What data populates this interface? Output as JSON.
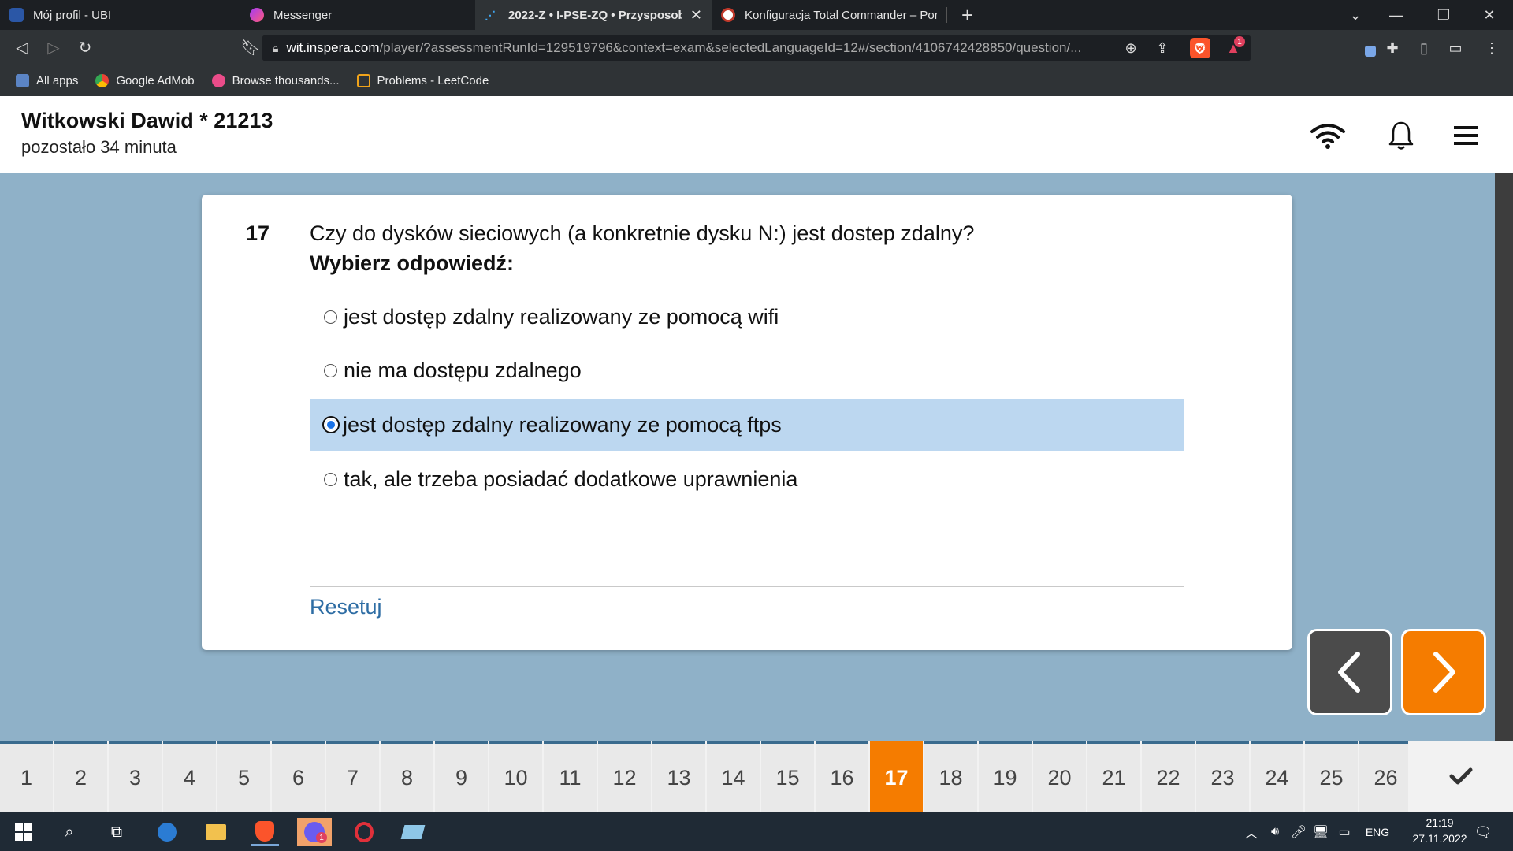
{
  "browser": {
    "tabs": [
      {
        "title": "Mój profil - UBI",
        "active": false
      },
      {
        "title": "Messenger",
        "active": false
      },
      {
        "title": "2022-Z • I-PSE-ZQ • Przysposobie",
        "active": true
      },
      {
        "title": "Konfiguracja Total Commander – Pom",
        "active": false
      }
    ],
    "url_host": "wit.inspera.com",
    "url_rest": "/player/?assessmentRunId=129519796&context=exam&selectedLanguageId=12#/section/4106742428850/question/...",
    "bookmarks": [
      "All apps",
      "Google AdMob",
      "Browse thousands...",
      "Problems - LeetCode"
    ],
    "notification_count": "1"
  },
  "header": {
    "candidate": "Witkowski Dawid * 21213",
    "time_left": "pozostało 34 minuta"
  },
  "question": {
    "number": "17",
    "text": "Czy do dysków sieciowych (a konkretnie dysku N:) jest dostep zdalny?",
    "instruction": "Wybierz odpowiedź:",
    "options": [
      {
        "label": "jest dostęp zdalny realizowany ze pomocą wifi",
        "selected": false
      },
      {
        "label": "nie ma dostępu zdalnego",
        "selected": false
      },
      {
        "label": "jest dostęp zdalny realizowany ze pomocą ftps",
        "selected": true
      },
      {
        "label": "tak, ale trzeba posiadać dodatkowe uprawnienia",
        "selected": false
      }
    ],
    "reset_label": "Resetuj"
  },
  "navigation": {
    "current": "17",
    "questions": [
      "1",
      "2",
      "3",
      "4",
      "5",
      "6",
      "7",
      "8",
      "9",
      "10",
      "11",
      "12",
      "13",
      "14",
      "15",
      "16",
      "17",
      "18",
      "19",
      "20",
      "21",
      "22",
      "23",
      "24",
      "25",
      "26"
    ]
  },
  "taskbar": {
    "language": "ENG",
    "time": "21:19",
    "date": "27.11.2022",
    "notification_badge": "1"
  },
  "colors": {
    "accent_orange": "#f57c00",
    "selected_option": "#bcd7f0",
    "page_background": "#8fb1c8"
  }
}
